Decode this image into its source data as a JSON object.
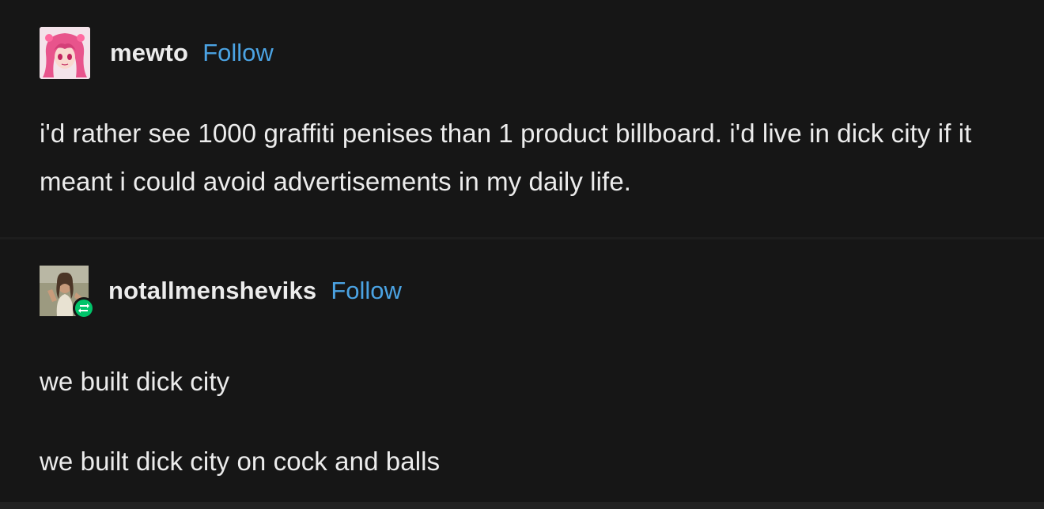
{
  "posts": [
    {
      "username": "mewto",
      "follow_label": "Follow",
      "avatar_icon": "anime-pink-hair-avatar",
      "paragraphs": [
        "i'd rather see 1000 graffiti penises than 1 product billboard. i'd live in dick city if it meant i could avoid advertisements in my daily life."
      ]
    },
    {
      "username": "notallmensheviks",
      "follow_label": "Follow",
      "avatar_icon": "photo-avatar",
      "reblog_icon": "reblog-icon",
      "paragraphs": [
        "we built dick city",
        "we built dick city on cock and balls"
      ]
    }
  ],
  "colors": {
    "background": "#161616",
    "text": "#ececec",
    "follow": "#4ba3e3",
    "reblog_badge": "#00c46a"
  }
}
